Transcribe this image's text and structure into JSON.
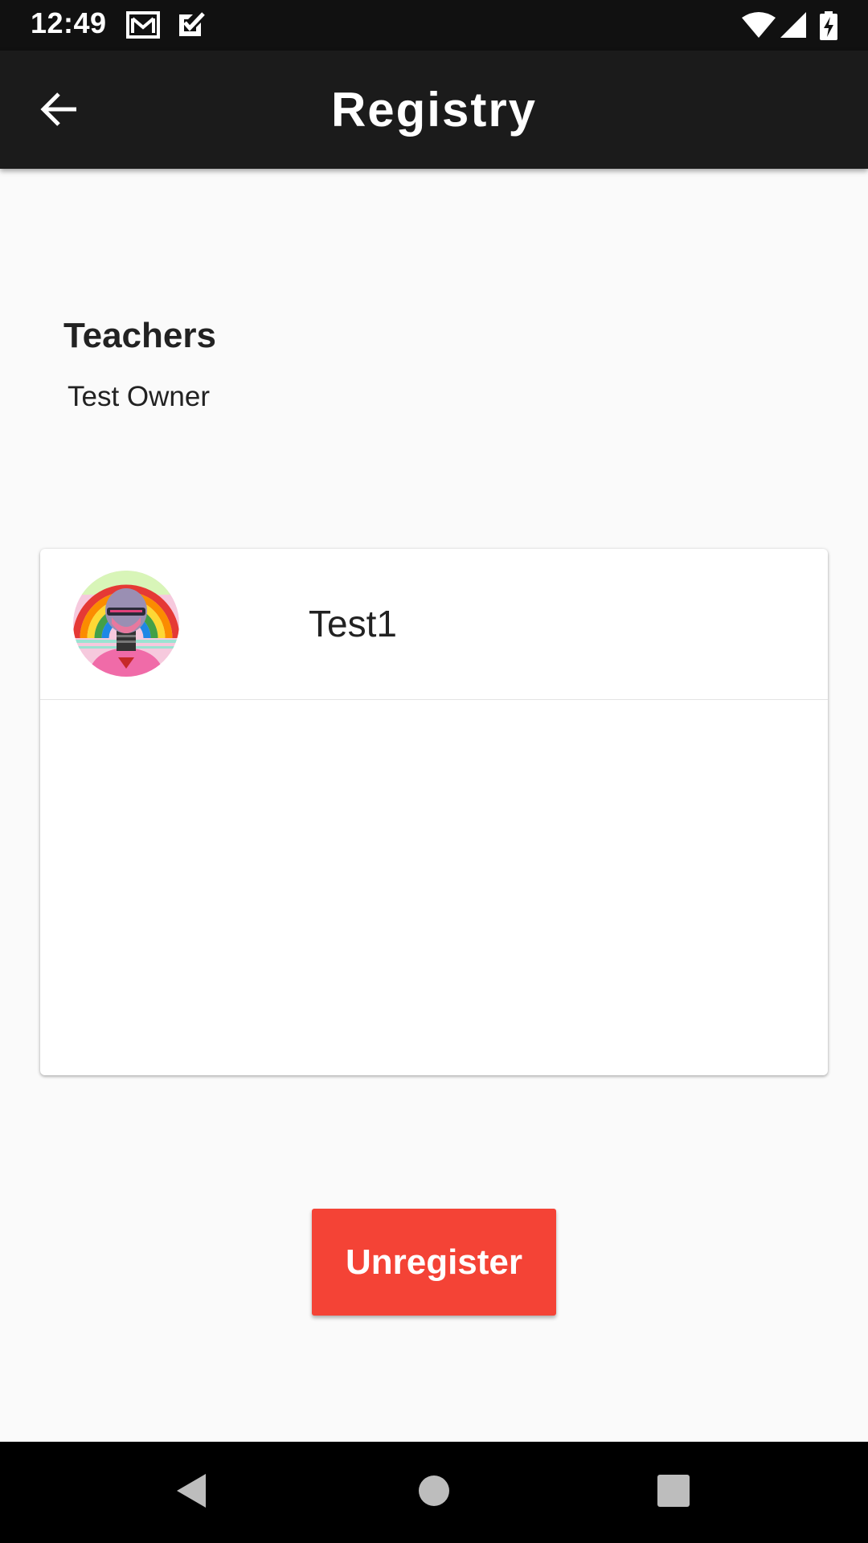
{
  "status_bar": {
    "time": "12:49",
    "icons": [
      "gmail-icon",
      "checkbox-icon",
      "wifi-icon",
      "signal-icon",
      "battery-charging-icon"
    ]
  },
  "app_bar": {
    "title": "Registry",
    "back_icon": "arrow-left-icon"
  },
  "teachers": {
    "heading": "Teachers",
    "names": [
      "Test Owner"
    ]
  },
  "student_card": {
    "avatar": "robot-avatar",
    "name": "Test1"
  },
  "actions": {
    "unregister_label": "Unregister"
  },
  "nav_bar": {
    "buttons": [
      "back-triangle-icon",
      "home-circle-icon",
      "recents-square-icon"
    ]
  },
  "colors": {
    "status_bar": "#111111",
    "app_bar": "#1b1b1b",
    "background": "#fafafa",
    "card": "#ffffff",
    "danger": "#f44336",
    "nav_bar": "#000000"
  }
}
